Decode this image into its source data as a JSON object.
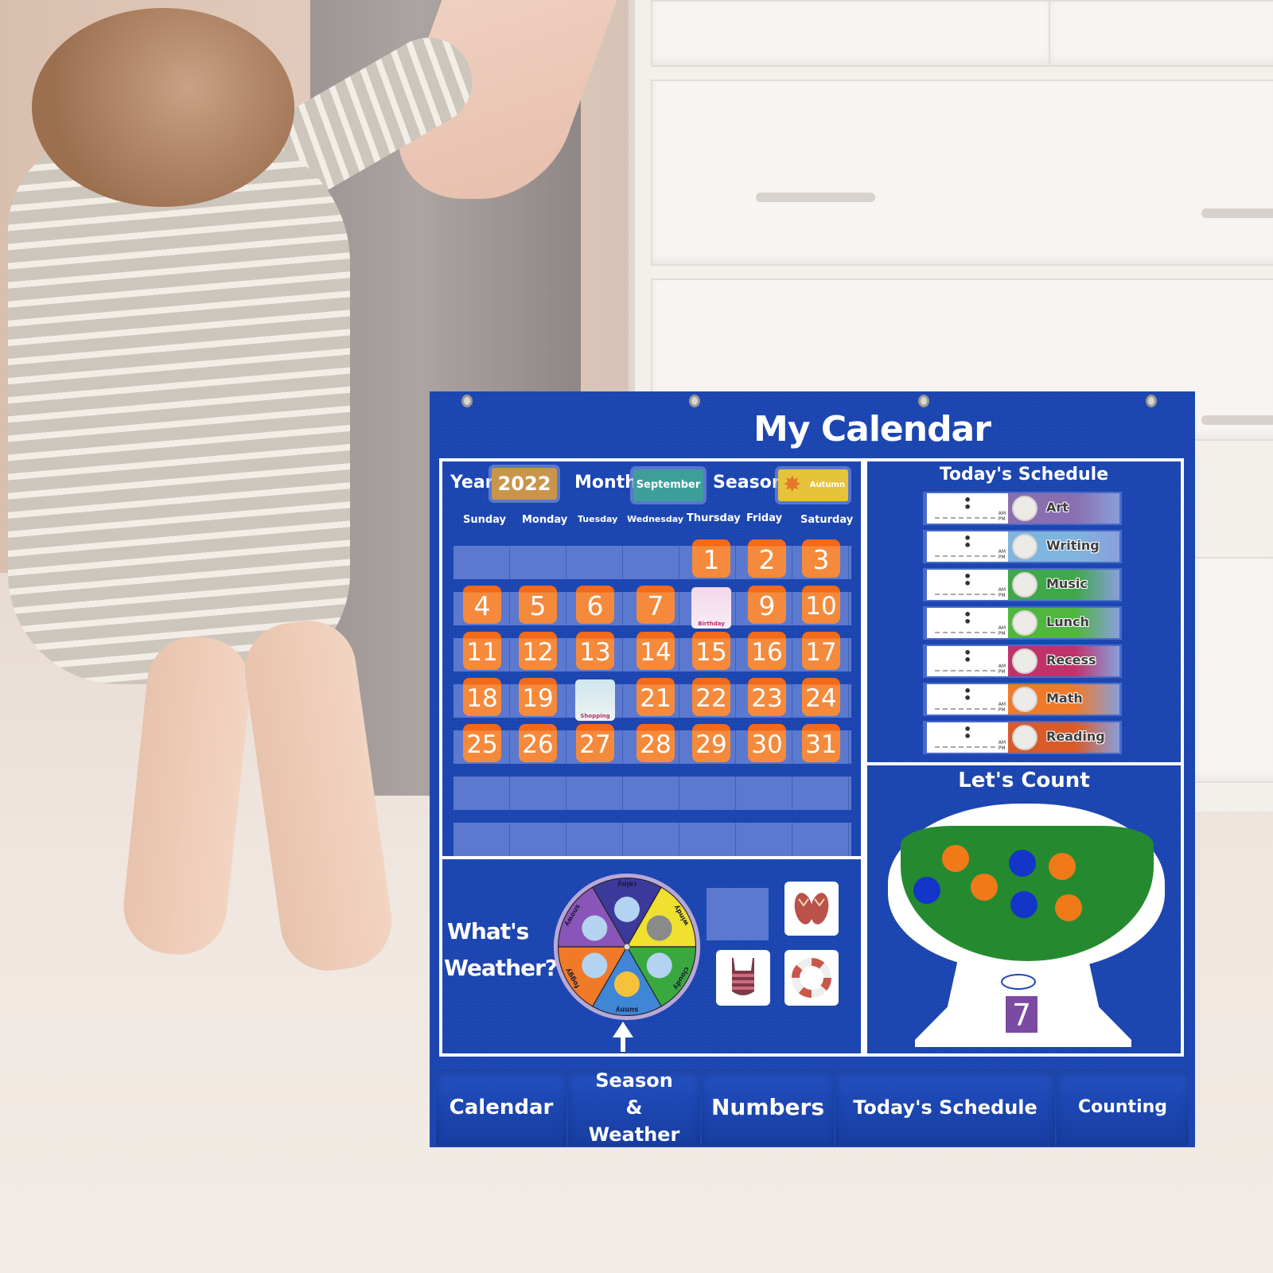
{
  "scene": {
    "description": "Toddler holding adult's hand next to a blue pocket calendar chart hanging in front of a white dresser"
  },
  "board": {
    "title": "My Calendar",
    "colors": {
      "board": "#1b45b0",
      "date_card": "#f58a3c",
      "pocket": "#5a79cf"
    },
    "calendar": {
      "year_label": "Year",
      "year_value": "2022",
      "month_label": "Month",
      "month_value": "September",
      "season_label": "Season",
      "season_value": "Autumn",
      "weekdays": [
        "Sunday",
        "Monday",
        "Tuesday",
        "Wednesday",
        "Thursday",
        "Friday",
        "Saturday"
      ],
      "weeks": [
        [
          "",
          "",
          "",
          "",
          "1",
          "2",
          "3"
        ],
        [
          "4",
          "5",
          "6",
          "7",
          "Birthday",
          "9",
          "10"
        ],
        [
          "11",
          "12",
          "13",
          "14",
          "15",
          "16",
          "17"
        ],
        [
          "18",
          "19",
          "Shopping",
          "21",
          "22",
          "23",
          "24"
        ],
        [
          "25",
          "26",
          "27",
          "28",
          "29",
          "30",
          "31"
        ]
      ],
      "event_cards": [
        {
          "label": "Birthday",
          "replaces_date": "8"
        },
        {
          "label": "Shopping",
          "replaces_date": "20"
        }
      ]
    },
    "schedule": {
      "title": "Today's Schedule",
      "time_placeholder": ":",
      "am": "AM",
      "pm": "PM",
      "items": [
        {
          "label": "Art",
          "color": "#8a6fb0"
        },
        {
          "label": "Writing",
          "color": "#7fb5df"
        },
        {
          "label": "Music",
          "color": "#3fa84a"
        },
        {
          "label": "Lunch",
          "color": "#4fb63f"
        },
        {
          "label": "Recess",
          "color": "#c0336a"
        },
        {
          "label": "Math",
          "color": "#ef7a2a"
        },
        {
          "label": "Reading",
          "color": "#d95b2a"
        }
      ]
    },
    "counting": {
      "title": "Let's Count",
      "count_value": "7",
      "orange_balls": 4,
      "blue_balls": 3
    },
    "weather": {
      "label_line1": "What's",
      "label_line2": "Weather?",
      "wheel_segments": [
        {
          "label": "rainy",
          "color": "#3b3a9a"
        },
        {
          "label": "windy",
          "color": "#f0e030"
        },
        {
          "label": "cloudy",
          "color": "#3aa83f"
        },
        {
          "label": "sunny",
          "color": "#3f86d6"
        },
        {
          "label": "foggy",
          "color": "#f07a28"
        },
        {
          "label": "snowy",
          "color": "#8a55b8"
        }
      ],
      "selected": "sunny",
      "clothing_cards": [
        "empty",
        "flip-flops",
        "swimsuit",
        "life-ring"
      ]
    },
    "storage_pockets": [
      "Calendar",
      "Season & Weather",
      "Numbers",
      "Today's Schedule",
      "Counting"
    ]
  }
}
